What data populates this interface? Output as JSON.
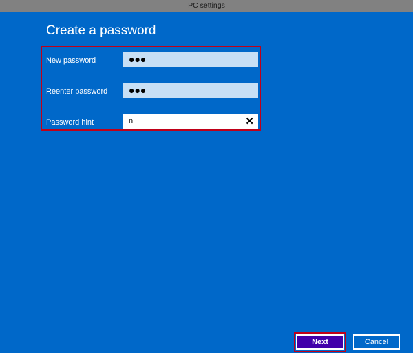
{
  "window": {
    "title": "PC settings"
  },
  "page": {
    "heading": "Create a password"
  },
  "form": {
    "new_password": {
      "label": "New password",
      "value": "●●●"
    },
    "reenter_password": {
      "label": "Reenter password",
      "value": "●●●"
    },
    "password_hint": {
      "label": "Password hint",
      "value": "n",
      "clear_icon": "✕"
    }
  },
  "buttons": {
    "next": "Next",
    "cancel": "Cancel"
  },
  "colors": {
    "background": "#0068c9",
    "highlight": "#c00018",
    "primary_button": "#4200aa"
  }
}
